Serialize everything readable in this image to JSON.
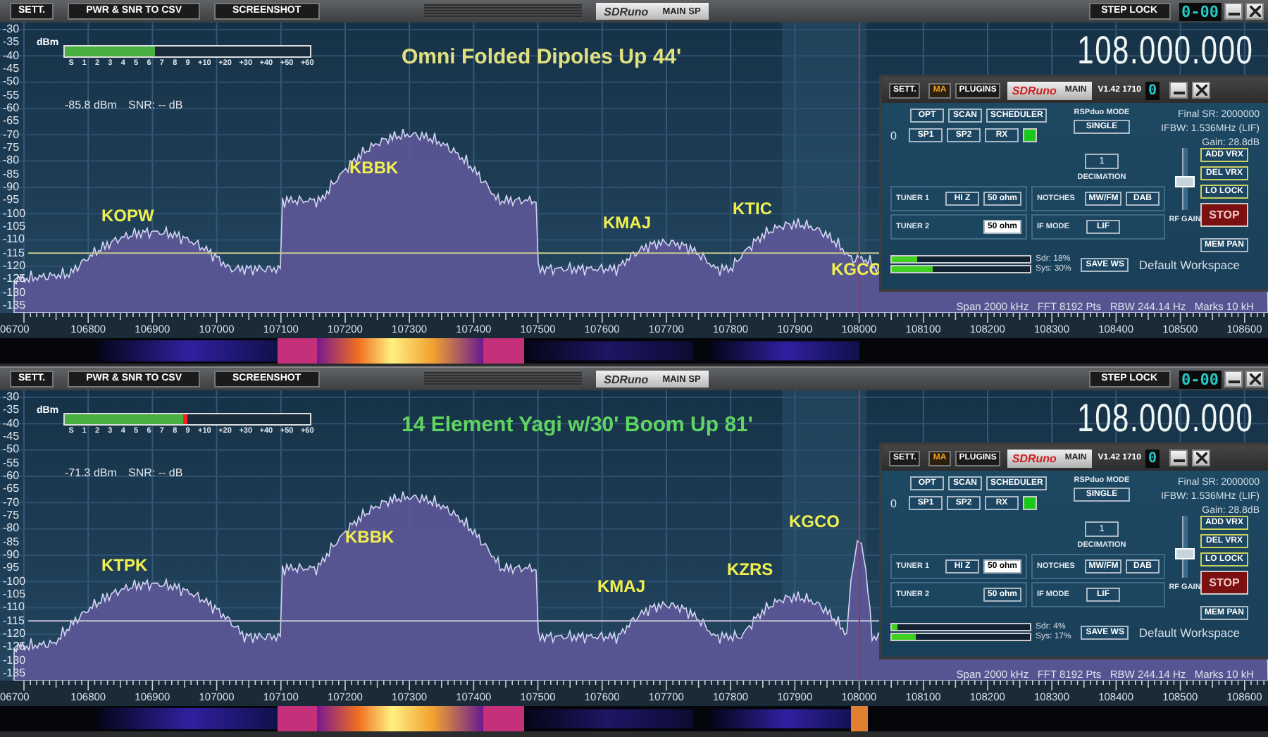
{
  "panels": [
    {
      "toolbar": {
        "buttons": [
          "SETT.",
          "PWR & SNR TO CSV",
          "SCREENSHOT"
        ],
        "logo": "SDRuno",
        "tab": "MAIN SP",
        "step_lock": "STEP LOCK",
        "counter": "0-00"
      },
      "y_ticks": [
        "-30",
        "-35",
        "-40",
        "-45",
        "-50",
        "-55",
        "-60",
        "-65",
        "-70",
        "-75",
        "-80",
        "-85",
        "-90",
        "-95",
        "-100",
        "-105",
        "-110",
        "-115",
        "-120",
        "-125",
        "-130",
        "-135"
      ],
      "meter": {
        "unit": "dBm",
        "scale": [
          "S",
          "1",
          "2",
          "3",
          "4",
          "5",
          "6",
          "7",
          "8",
          "9",
          "+10",
          "+20",
          "+30",
          "+40",
          "+50",
          "+60"
        ],
        "level": 0.37,
        "peak_marker": false
      },
      "power": "-85.8 dBm",
      "snr": "SNR: -- dB",
      "title": {
        "text": "Omni Folded Dipoles Up 44'",
        "color": "#e0e080"
      },
      "frequency": "108.000.000",
      "stations": [
        "KOPW",
        "KBBK",
        "KMAJ",
        "KTIC",
        "KGCO"
      ],
      "status": "Span 2000 kHz   FFT 8192 Pts   RBW 244.14 Hz   Marks 10 kH",
      "x_ticks": [
        "06700",
        "106800",
        "106900",
        "107000",
        "107100",
        "107200",
        "107300",
        "107400",
        "107500",
        "107600",
        "107700",
        "107800",
        "107900",
        "108000",
        "108100",
        "108200",
        "108300",
        "108400",
        "108500",
        "108600"
      ],
      "main_window": {
        "header_buttons": [
          {
            "label": "SETT.",
            "kind": "plain"
          },
          {
            "label": "MA",
            "kind": "accent"
          },
          {
            "label": "PLUGINS",
            "kind": "plain"
          }
        ],
        "logo": "SDRuno",
        "tab": "MAIN",
        "version": "V1.42 1710",
        "counter": "0",
        "row1": [
          "OPT",
          "SCAN",
          "SCHEDULER"
        ],
        "vrx": "0",
        "row2": [
          "SP1",
          "SP2",
          "RX"
        ],
        "rx_on": true,
        "mode_label": "RSPduo MODE",
        "mode": "SINGLE",
        "final_sr": "Final SR: 2000000",
        "ifbw": "IFBW: 1.536MHz (LIF)",
        "gain": "Gain: 28.8dB",
        "decimation_value": "1",
        "decimation_label": "DECIMATION",
        "tuner1": {
          "label": "TUNER 1",
          "options": [
            {
              "label": "HI Z",
              "selected": false
            },
            {
              "label": "50 ohm",
              "selected": false
            }
          ]
        },
        "tuner2": {
          "label": "TUNER 2",
          "options": [
            {
              "label": "50 ohm",
              "selected": true
            }
          ]
        },
        "notches": {
          "label": "NOTCHES",
          "options": [
            "MW/FM",
            "DAB"
          ]
        },
        "if_mode": {
          "label": "IF MODE",
          "value": "LIF"
        },
        "rf_gain": {
          "label": "RF GAIN",
          "level": 0.45
        },
        "side_buttons": [
          "ADD VRX",
          "DEL VRX",
          "LO LOCK"
        ],
        "stop": "STOP",
        "mem_pan": "MEM PAN",
        "sdr": {
          "label": "Sdr: 18%",
          "level": 0.18
        },
        "sys": {
          "label": "Sys: 30%",
          "level": 0.3
        },
        "save_ws": "SAVE WS",
        "workspace": "Default Workspace"
      }
    },
    {
      "toolbar": {
        "buttons": [
          "SETT.",
          "PWR & SNR TO CSV",
          "SCREENSHOT"
        ],
        "logo": "SDRuno",
        "tab": "MAIN SP",
        "step_lock": "STEP LOCK",
        "counter": "0-00"
      },
      "y_ticks": [
        "-30",
        "-35",
        "-40",
        "-45",
        "-50",
        "-55",
        "-60",
        "-65",
        "-70",
        "-75",
        "-80",
        "-85",
        "-90",
        "-95",
        "-100",
        "-105",
        "-110",
        "-115",
        "-120",
        "-125",
        "-130",
        "-135"
      ],
      "meter": {
        "unit": "dBm",
        "scale": [
          "S",
          "1",
          "2",
          "3",
          "4",
          "5",
          "6",
          "7",
          "8",
          "9",
          "+10",
          "+20",
          "+30",
          "+40",
          "+50",
          "+60"
        ],
        "level": 0.48,
        "peak_marker": true
      },
      "power": "-71.3 dBm",
      "snr": "SNR: -- dB",
      "title": {
        "text": "14 Element Yagi w/30' Boom Up 81'",
        "color": "#5fd45f"
      },
      "frequency": "108.000.000",
      "stations": [
        "KTPK",
        "KBBK",
        "KMAJ",
        "KZRS",
        "KGCO"
      ],
      "status": "Span 2000 kHz   FFT 8192 Pts   RBW 244.14 Hz   Marks 10 kH",
      "x_ticks": [
        "06700",
        "106800",
        "106900",
        "107000",
        "107100",
        "107200",
        "107300",
        "107400",
        "107500",
        "107600",
        "107700",
        "107800",
        "107900",
        "108000",
        "108100",
        "108200",
        "108300",
        "108400",
        "108500",
        "108600"
      ],
      "main_window": {
        "header_buttons": [
          {
            "label": "SETT.",
            "kind": "plain"
          },
          {
            "label": "MA",
            "kind": "accent"
          },
          {
            "label": "PLUGINS",
            "kind": "plain"
          }
        ],
        "logo": "SDRuno",
        "tab": "MAIN",
        "version": "V1.42 1710",
        "counter": "0",
        "row1": [
          "OPT",
          "SCAN",
          "SCHEDULER"
        ],
        "vrx": "0",
        "row2": [
          "SP1",
          "SP2",
          "RX"
        ],
        "rx_on": true,
        "mode_label": "RSPduo MODE",
        "mode": "SINGLE",
        "final_sr": "Final SR: 2000000",
        "ifbw": "IFBW: 1.536MHz (LIF)",
        "gain": "Gain: 28.8dB",
        "decimation_value": "1",
        "decimation_label": "DECIMATION",
        "tuner1": {
          "label": "TUNER 1",
          "options": [
            {
              "label": "HI Z",
              "selected": false
            },
            {
              "label": "50 ohm",
              "selected": true
            }
          ]
        },
        "tuner2": {
          "label": "TUNER 2",
          "options": [
            {
              "label": "50 ohm",
              "selected": false
            }
          ]
        },
        "notches": {
          "label": "NOTCHES",
          "options": [
            "MW/FM",
            "DAB"
          ]
        },
        "if_mode": {
          "label": "IF MODE",
          "value": "LIF"
        },
        "rf_gain": {
          "label": "RF GAIN",
          "level": 0.35
        },
        "side_buttons": [
          "ADD VRX",
          "DEL VRX",
          "LO LOCK"
        ],
        "stop": "STOP",
        "mem_pan": "MEM PAN",
        "sdr": {
          "label": "Sdr: 4%",
          "level": 0.04
        },
        "sys": {
          "label": "Sys: 17%",
          "level": 0.17
        },
        "save_ws": "SAVE WS",
        "workspace": "Default Workspace"
      }
    }
  ]
}
